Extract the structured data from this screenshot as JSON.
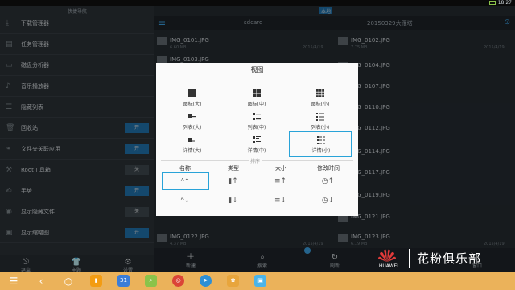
{
  "statusbar": {
    "clock": "18:27",
    "top_tag": "本地"
  },
  "drawer": {
    "title": "快捷导航",
    "items": [
      {
        "label": "下载管理器",
        "icon": "download-icon",
        "toggle": ""
      },
      {
        "label": "任务管理器",
        "icon": "task-icon",
        "toggle": ""
      },
      {
        "label": "磁盘分析器",
        "icon": "disk-icon",
        "toggle": ""
      },
      {
        "label": "音乐播放器",
        "icon": "music-icon",
        "toggle": ""
      },
      {
        "label": "隐藏列表",
        "icon": "list-icon",
        "toggle": ""
      },
      {
        "label": "回收站",
        "icon": "trash-icon",
        "toggle": "开"
      },
      {
        "label": "文件夹关联应用",
        "icon": "link-icon",
        "toggle": "开"
      },
      {
        "label": "Root工具箱",
        "icon": "root-icon",
        "toggle": "关"
      },
      {
        "label": "手势",
        "icon": "gesture-icon",
        "toggle": "开"
      },
      {
        "label": "显示隐藏文件",
        "icon": "eye-icon",
        "toggle": "关"
      },
      {
        "label": "显示缩略图",
        "icon": "image-icon",
        "toggle": "开"
      }
    ],
    "bottom": [
      {
        "label": "退出",
        "icon": "exit-icon"
      },
      {
        "label": "主题",
        "icon": "shirt-icon"
      },
      {
        "label": "设置",
        "icon": "gear-icon"
      }
    ]
  },
  "pane": {
    "location": "sdcard",
    "folder": "20150329大雁塔",
    "files": [
      {
        "name": "IMG_0101.JPG",
        "meta": "6.60 MB",
        "perm": "rw",
        "date": "2015/4/19"
      },
      {
        "name": "IMG_0102.JPG",
        "meta": "7.75 MB",
        "perm": "rw",
        "date": "2015/4/19"
      },
      {
        "name": "IMG_0103.JPG",
        "meta": "",
        "perm": "",
        "date": ""
      },
      {
        "name": "IMG_0104.JPG",
        "meta": "",
        "perm": "",
        "date": ""
      },
      {
        "name": "IMG_0107.JPG",
        "meta": "",
        "perm": "",
        "date": ""
      },
      {
        "name": "IMG_0110.JPG",
        "meta": "",
        "perm": "",
        "date": ""
      },
      {
        "name": "IMG_0112.JPG",
        "meta": "",
        "perm": "",
        "date": ""
      },
      {
        "name": "IMG_0114.JPG",
        "meta": "",
        "perm": "",
        "date": ""
      },
      {
        "name": "IMG_0117.JPG",
        "meta": "",
        "perm": "",
        "date": ""
      },
      {
        "name": "IMG_0119.JPG",
        "meta": "",
        "perm": "",
        "date": ""
      },
      {
        "name": "IMG_0121.JPG",
        "meta": "",
        "perm": "",
        "date": ""
      },
      {
        "name": "IMG_0122.JPG",
        "meta": "4.37 MB",
        "perm": "rw",
        "date": "2015/4/19"
      },
      {
        "name": "IMG_0123.JPG",
        "meta": "6.19 MB",
        "perm": "rw",
        "date": "2015/4/19"
      }
    ],
    "bottom": [
      {
        "label": "新建",
        "icon": "plus-icon"
      },
      {
        "label": "搜索",
        "icon": "search-icon"
      },
      {
        "label": "刷新",
        "icon": "refresh-icon"
      },
      {
        "label": "窗口",
        "icon": "window-icon"
      }
    ]
  },
  "dialog": {
    "title": "视图",
    "view_options": [
      {
        "label": "图标(大)",
        "icon": "grid-large-icon"
      },
      {
        "label": "图标(中)",
        "icon": "grid-medium-icon"
      },
      {
        "label": "图标(小)",
        "icon": "grid-small-icon"
      },
      {
        "label": "列表(大)",
        "icon": "list-large-icon"
      },
      {
        "label": "列表(中)",
        "icon": "list-medium-icon"
      },
      {
        "label": "列表(小)",
        "icon": "list-small-icon"
      },
      {
        "label": "详情(大)",
        "icon": "detail-large-icon"
      },
      {
        "label": "详情(中)",
        "icon": "detail-medium-icon"
      },
      {
        "label": "详情(小)",
        "icon": "detail-small-icon"
      }
    ],
    "selected_view": "详情(小)",
    "sort_label": "排序",
    "sort_headers": [
      "名称",
      "类型",
      "大小",
      "修改时间"
    ],
    "sort_icons_asc": [
      "sort-name-asc-icon",
      "sort-type-asc-icon",
      "sort-size-asc-icon",
      "sort-time-asc-icon"
    ],
    "sort_icons_desc": [
      "sort-name-desc-icon",
      "sort-type-desc-icon",
      "sort-size-desc-icon",
      "sort-time-desc-icon"
    ],
    "selected_sort": "名称"
  },
  "watermark": {
    "brand": "HUAWEI",
    "text": "花粉俱乐部"
  },
  "colors": {
    "accent": "#29a3d8",
    "navbar": "#ebb25a",
    "toggle_on": "#1f6fa8"
  }
}
